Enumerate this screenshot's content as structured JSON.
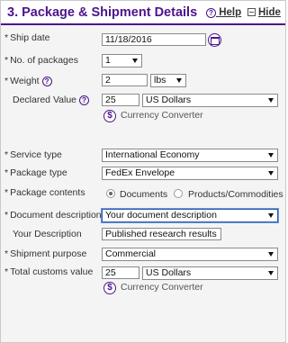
{
  "header": {
    "title": "3. Package & Shipment Details",
    "help_label": "Help",
    "hide_label": "Hide"
  },
  "icons": {
    "help": "?",
    "currency": "$"
  },
  "accent_color": "#4d148c",
  "fields": {
    "ship_date": {
      "label": "Ship date",
      "value": "11/18/2016"
    },
    "num_packages": {
      "label": "No. of packages",
      "value": "1"
    },
    "weight": {
      "label": "Weight",
      "value": "2",
      "unit": "lbs"
    },
    "declared_value": {
      "label": "Declared Value",
      "amount": "25",
      "currency": "US Dollars",
      "converter": "Currency Converter"
    },
    "service_type": {
      "label": "Service type",
      "value": "International Economy"
    },
    "package_type": {
      "label": "Package type",
      "value": "FedEx Envelope"
    },
    "package_contents": {
      "label": "Package contents",
      "options": [
        "Documents",
        "Products/Commodities"
      ],
      "selected": "Documents"
    },
    "document_description": {
      "label": "Document description",
      "value": "Your document description"
    },
    "your_description": {
      "label": "Your Description",
      "value": "Published research results"
    },
    "shipment_purpose": {
      "label": "Shipment purpose",
      "value": "Commercial"
    },
    "total_customs": {
      "label": "Total customs value",
      "amount": "25",
      "currency": "US Dollars",
      "converter": "Currency Converter"
    }
  }
}
